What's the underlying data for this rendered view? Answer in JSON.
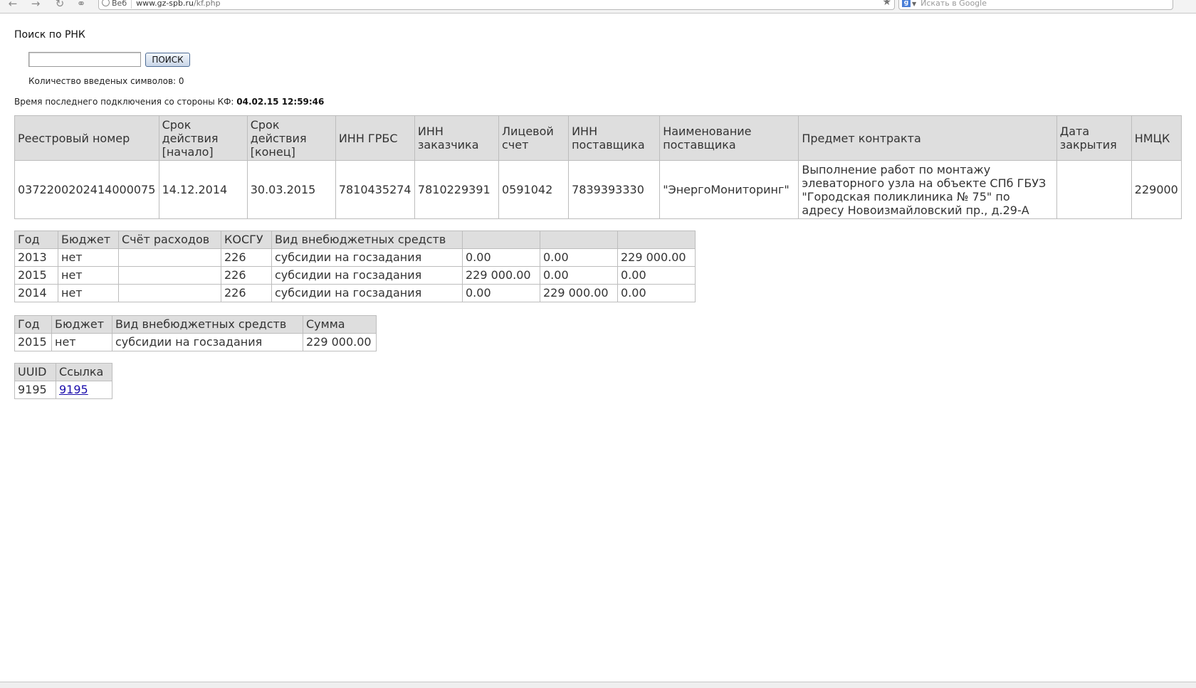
{
  "browser": {
    "back_icon": "back-arrow-icon",
    "forward_icon": "forward-arrow-icon",
    "reload_icon": "reload-icon",
    "key_icon": "key-icon",
    "web_label": "Веб",
    "url_domain": "www.gz-spb.ru",
    "url_path": "/kf.php",
    "search_placeholder": "Искать в Google"
  },
  "page": {
    "title": "Поиск по РНК",
    "search_value": "",
    "search_button": "ПОИСК",
    "count_label": "Количество введеных символов: 0",
    "last_conn_label": "Время последнего подключения со стороны КФ:",
    "last_conn_value": "04.02.15 12:59:46"
  },
  "contract_table": {
    "headers": [
      "Реестровый номер",
      "Срок действия [начало]",
      "Срок действия [конец]",
      "ИНН ГРБС",
      "ИНН заказчика",
      "Лицевой счет",
      "ИНН поставщика",
      "Наименование поставщика",
      "Предмет контракта",
      "Дата закрытия",
      "НМЦК"
    ],
    "rows": [
      [
        "0372200202414000075",
        "14.12.2014",
        "30.03.2015",
        "7810435274",
        "7810229391",
        "0591042",
        "7839393330",
        "\"ЭнергоМониторинг\"",
        "Выполнение работ по монтажу элеваторного узла на объекте СПб ГБУЗ \"Городская поликлиника № 75\" по адресу Новоизмайловский пр., д.29-А",
        "",
        "229000"
      ]
    ]
  },
  "budget_table": {
    "headers": [
      "Год",
      "Бюджет",
      "Счёт расходов",
      "КОСГУ",
      "Вид внебюджетных средств",
      "",
      "",
      ""
    ],
    "rows": [
      [
        " 2013",
        "нет",
        "",
        " 226",
        " субсидии на госзадания",
        " 0.00",
        " 0.00",
        " 229 000.00"
      ],
      [
        " 2015",
        "нет",
        "",
        " 226",
        " субсидии на госзадания",
        " 229 000.00",
        " 0.00",
        " 0.00"
      ],
      [
        " 2014",
        "нет",
        "",
        " 226",
        " субсидии на госзадания",
        " 0.00",
        " 229 000.00",
        " 0.00"
      ]
    ]
  },
  "sum_table": {
    "headers": [
      "Год",
      "Бюджет",
      "Вид внебюджетных средств",
      "Сумма"
    ],
    "rows": [
      [
        "2015",
        "нет",
        " субсидии на госзадания",
        "229 000.00"
      ]
    ]
  },
  "uuid_table": {
    "headers": [
      "UUID",
      "Ссылка"
    ],
    "rows": [
      [
        "9195",
        "9195"
      ]
    ]
  }
}
